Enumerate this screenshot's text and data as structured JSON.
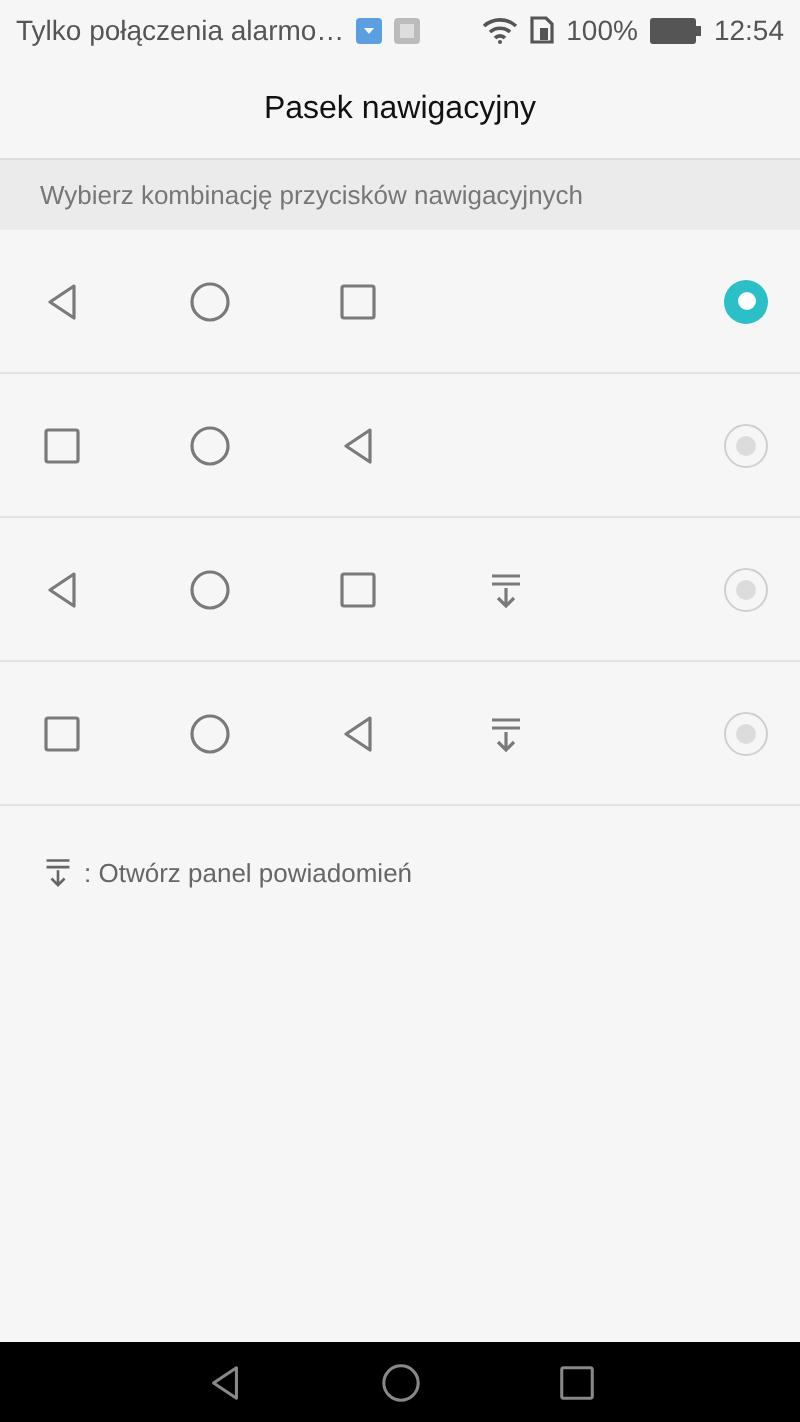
{
  "status_bar": {
    "notice": "Tylko połączenia alarmo…",
    "battery": "100%",
    "time": "12:54"
  },
  "title": "Pasek nawigacyjny",
  "section_header": "Wybierz kombinację przycisków nawigacyjnych",
  "options": [
    {
      "selected": true,
      "buttons": [
        {
          "kind": "back"
        },
        {
          "kind": "home"
        },
        {
          "kind": "recent"
        }
      ]
    },
    {
      "selected": false,
      "buttons": [
        {
          "kind": "recent"
        },
        {
          "kind": "home"
        },
        {
          "kind": "back"
        }
      ]
    },
    {
      "selected": false,
      "buttons": [
        {
          "kind": "back"
        },
        {
          "kind": "home"
        },
        {
          "kind": "recent"
        },
        {
          "kind": "notify"
        }
      ]
    },
    {
      "selected": false,
      "buttons": [
        {
          "kind": "recent"
        },
        {
          "kind": "home"
        },
        {
          "kind": "back"
        },
        {
          "kind": "notify"
        }
      ]
    }
  ],
  "note": {
    "kind": "notify",
    "text": ": Otwórz panel powiadomień"
  },
  "nav_bar": [
    {
      "kind": "back"
    },
    {
      "kind": "home"
    },
    {
      "kind": "recent"
    }
  ]
}
